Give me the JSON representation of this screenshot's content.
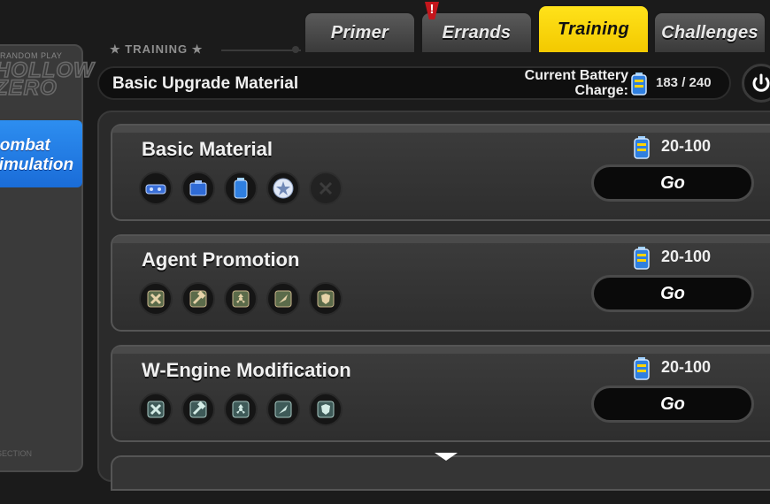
{
  "tabs": [
    {
      "label": "Primer",
      "active": false
    },
    {
      "label": "Errands",
      "active": false,
      "alert": "!"
    },
    {
      "label": "Training",
      "active": true
    },
    {
      "label": "Challenges",
      "active": false
    }
  ],
  "sidebar": {
    "logo_small": "RANDOM PLAY",
    "logo_big_line1": "HOLLOW",
    "logo_big_line2": "ZERO",
    "active_item_line1": "Combat",
    "active_item_line2": "Simulation",
    "footer": "SECTION"
  },
  "header": {
    "section_label": "★ TRAINING ★",
    "title": "Basic Upgrade Material",
    "charge_label_line1": "Current Battery",
    "charge_label_line2": "Charge:",
    "charge_value": "183 / 240"
  },
  "cards": [
    {
      "title": "Basic Material",
      "cost": "20-100",
      "button": "Go",
      "icons": [
        "blue-chip-icon",
        "blue-case-icon",
        "blue-battery-icon",
        "silver-star-disk-icon",
        "locked-empty-icon"
      ]
    },
    {
      "title": "Agent Promotion",
      "cost": "20-100",
      "button": "Go",
      "icons": [
        "cross-swords-icon",
        "hammer-icon",
        "radiation-icon",
        "shell-icon",
        "shield-icon"
      ]
    },
    {
      "title": "W-Engine Modification",
      "cost": "20-100",
      "button": "Go",
      "icons": [
        "cross-swords-icon",
        "hammer-icon",
        "radiation-icon",
        "shell-icon",
        "shield-icon"
      ]
    }
  ],
  "colors": {
    "active_tab": "#f5cc00",
    "sidebar_active": "#2a86ee",
    "background": "#1b1b1b"
  }
}
